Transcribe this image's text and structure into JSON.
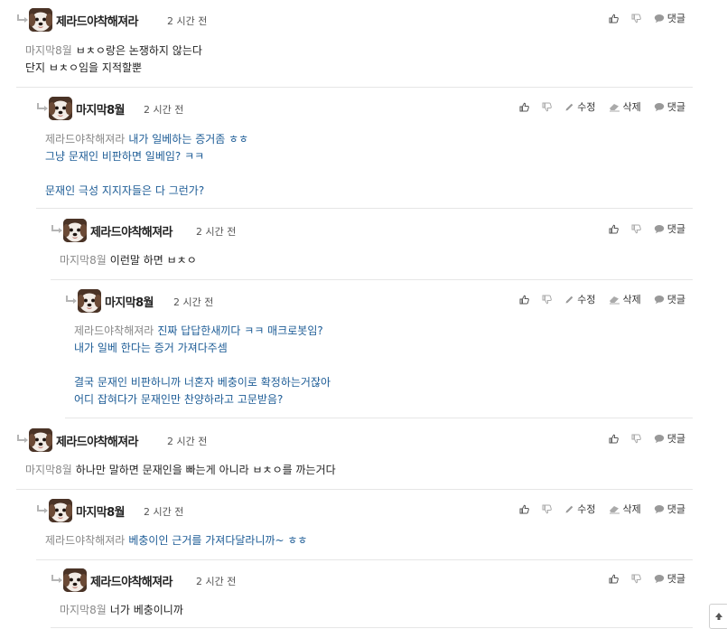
{
  "labels": {
    "reply": "댓글",
    "edit": "수정",
    "delete": "삭제"
  },
  "comments": [
    {
      "author": "제라드야착해져라",
      "time": "2 시간 전",
      "to": "마지막8월",
      "lines": [
        "ㅂㅊㅇ랑은 논쟁하지 않는다",
        "단지 ㅂㅊㅇ임을 지적할뿐"
      ],
      "owner": false
    },
    {
      "author": "마지막8월",
      "time": "2 시간 전",
      "to": "제라드야착해져라",
      "lines": [
        "내가 일베하는 증거좀 ㅎㅎ",
        "그냥 문재인 비판하면 일베임? ㅋㅋ",
        "",
        "문재인 극성 지지자들은 다 그런가?"
      ],
      "owner": true
    },
    {
      "author": "제라드야착해져라",
      "time": "2 시간 전",
      "to": "마지막8월",
      "lines": [
        "이런말 하면 ㅂㅊㅇ"
      ],
      "owner": false
    },
    {
      "author": "마지막8월",
      "time": "2 시간 전",
      "to": "제라드야착해져라",
      "lines": [
        "진짜 답답한새끼다 ㅋㅋ 매크로봇임?",
        "내가 일베 한다는 증거 가져다주셈",
        "",
        "결국 문재인 비판하니까 너혼자 베충이로 확정하는거잖아",
        "어디 잡혀다가 문재인만 찬양하라고 고문받음?"
      ],
      "owner": true
    },
    {
      "author": "제라드야착해져라",
      "time": "2 시간 전",
      "to": "마지막8월",
      "lines": [
        "하나만 말하면 문재인을 빠는게 아니라 ㅂㅊㅇ를 까는거다"
      ],
      "owner": false
    },
    {
      "author": "마지막8월",
      "time": "2 시간 전",
      "to": "제라드야착해져라",
      "lines": [
        "베충이인 근거를 가져다달라니까~ ㅎㅎ"
      ],
      "owner": true
    },
    {
      "author": "제라드야착해져라",
      "time": "2 시간 전",
      "to": "마지막8월",
      "lines": [
        "너가 베충이니까"
      ],
      "owner": false
    }
  ]
}
